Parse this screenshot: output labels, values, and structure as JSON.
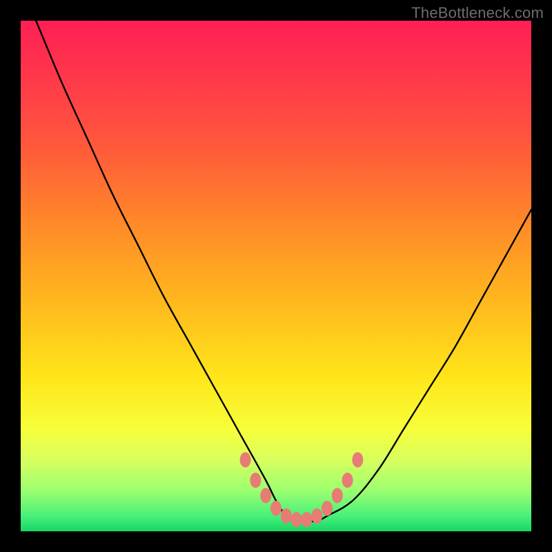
{
  "watermark": {
    "text": "TheBottleneck.com"
  },
  "colors": {
    "frame": "#000000",
    "gradient_top": "#ff1f54",
    "gradient_mid": "#ffe61a",
    "gradient_bottom": "#17d668",
    "curve_stroke": "#000000",
    "marker_fill": "#e77c74",
    "marker_stroke": "#b84f4a"
  },
  "chart_data": {
    "type": "line",
    "title": "",
    "xlabel": "",
    "ylabel": "",
    "xlim": [
      0,
      100
    ],
    "ylim": [
      0,
      100
    ],
    "x": [
      3,
      8,
      13,
      18,
      23,
      28,
      33,
      38,
      43,
      48,
      50,
      52,
      54,
      56,
      58,
      60,
      65,
      70,
      75,
      80,
      85,
      90,
      95,
      100
    ],
    "y": [
      100,
      88,
      77,
      66,
      56,
      46,
      37,
      28,
      19,
      10,
      6,
      3,
      2,
      2,
      2,
      3,
      6,
      12,
      20,
      28,
      36,
      45,
      54,
      63
    ],
    "markers_x": [
      44,
      46,
      48,
      50,
      52,
      54,
      56,
      58,
      60,
      62,
      64,
      66
    ],
    "markers_y": [
      14,
      10,
      7,
      4.5,
      3,
      2.3,
      2.3,
      3,
      4.5,
      7,
      10,
      14
    ]
  }
}
